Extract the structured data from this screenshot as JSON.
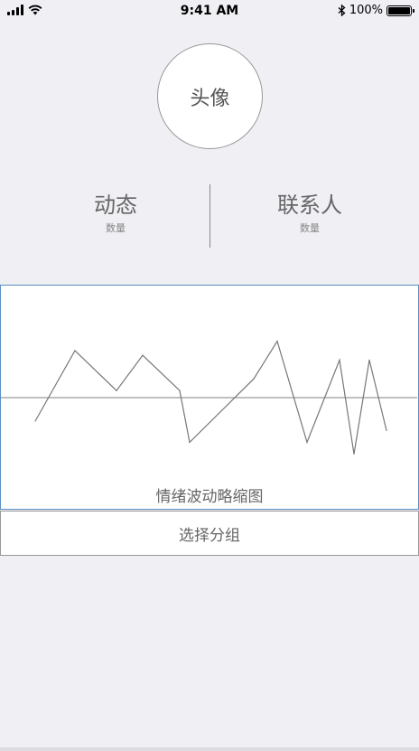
{
  "status_bar": {
    "time": "9:41 AM",
    "battery": "100%",
    "icons": [
      "signal-icon",
      "wifi-icon",
      "bluetooth-icon",
      "battery-icon"
    ]
  },
  "profile": {
    "avatar_label": "头像"
  },
  "stats": {
    "left": {
      "title": "动态",
      "label": "数量"
    },
    "right": {
      "title": "联系人",
      "label": "数量"
    }
  },
  "chart": {
    "caption": "情绪波动略缩图",
    "accent_color": "#5a8fc4"
  },
  "chart_data": {
    "type": "line",
    "title": "情绪波动略缩图",
    "xlabel": "",
    "ylabel": "",
    "baseline": 0,
    "grid": false,
    "ylim": [
      -1.4,
      1.4
    ],
    "series": [
      {
        "values": [
          -0.5,
          1.0,
          0.15,
          0.9,
          0.15,
          -0.95,
          0.4,
          1.2,
          -0.95,
          0.8,
          -1.2,
          0.8,
          -0.7
        ]
      }
    ]
  },
  "group_select": {
    "label": "选择分组"
  }
}
